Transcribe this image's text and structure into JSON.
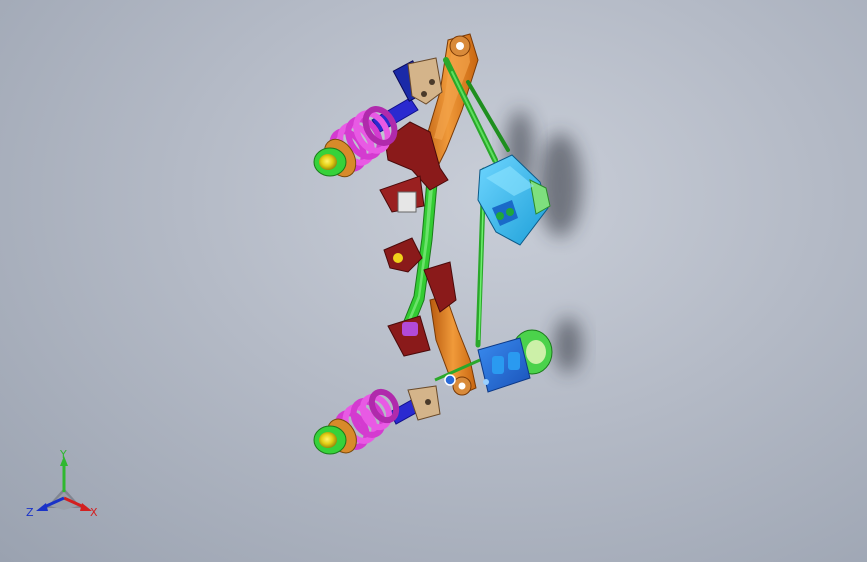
{
  "viewport": {
    "model": "rear-suspension-assembly",
    "colors": {
      "background_top": "#c9ced8",
      "background_bottom": "#9aa2b0",
      "spring": "#d43bd0",
      "spring_dark": "#8f1f8f",
      "strut_rod": "#2a2ad0",
      "hub_green": "#36d23a",
      "hub_yellow": "#e6e21a",
      "crossmember_green": "#33cc33",
      "bracket_red": "#8a1a1a",
      "arm_orange": "#e07a1a",
      "housing_cyan": "#31b8ee",
      "housing_blue": "#1f6fd8",
      "shadow": "#2a2e38"
    }
  },
  "triad": {
    "label_y": "Y",
    "label_x": "X",
    "label_z": "Z",
    "color_y": "#2fb82f",
    "color_x": "#d32020",
    "color_z": "#1a33c8"
  }
}
